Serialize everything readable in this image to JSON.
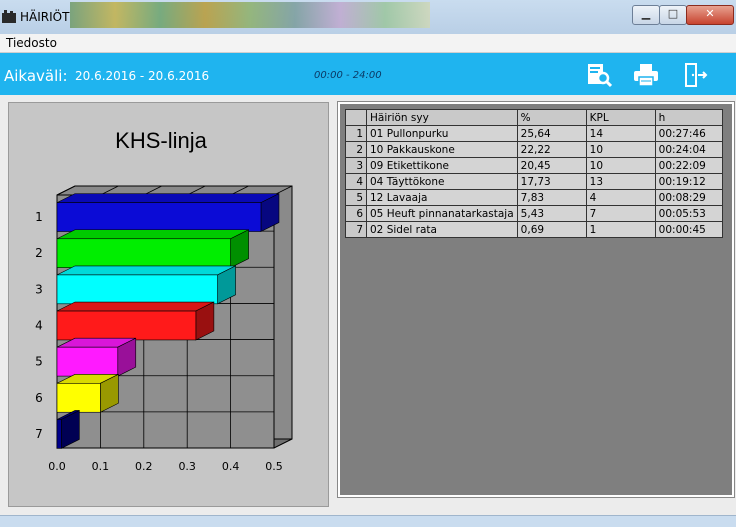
{
  "window": {
    "title": "HÄIRIÖT"
  },
  "menu": {
    "file": "Tiedosto"
  },
  "toolbar": {
    "period_label": "Aikaväli:",
    "dates": "20.6.2016  -  20.6.2016",
    "time": "00:00 - 24:00",
    "icons": [
      "search-report-icon",
      "printer-icon",
      "exit-icon"
    ]
  },
  "grid": {
    "headers": [
      "",
      "Häiriön syy",
      "%",
      "KPL",
      "h"
    ],
    "rows": [
      [
        "1",
        "01 Pullonpurku",
        "25,64",
        "14",
        "00:27:46"
      ],
      [
        "2",
        "10 Pakkauskone",
        "22,22",
        "10",
        "00:24:04"
      ],
      [
        "3",
        "09 Etikettikone",
        "20,45",
        "10",
        "00:22:09"
      ],
      [
        "4",
        "04 Täyttökone",
        "17,73",
        "13",
        "00:19:12"
      ],
      [
        "5",
        "12 Lavaaja",
        "7,83",
        "4",
        "00:08:29"
      ],
      [
        "6",
        "05 Heuft pinnanatarkastaja",
        "5,43",
        "7",
        "00:05:53"
      ],
      [
        "7",
        "02 Sidel rata",
        "0,69",
        "1",
        "00:00:45"
      ]
    ]
  },
  "chart_data": {
    "type": "bar",
    "orientation": "horizontal",
    "title": "KHS-linja",
    "categories": [
      "1",
      "2",
      "3",
      "4",
      "5",
      "6",
      "7"
    ],
    "values": [
      0.47,
      0.4,
      0.37,
      0.32,
      0.14,
      0.1,
      0.01
    ],
    "colors": [
      "#0b0bd6",
      "#00ee00",
      "#00ffff",
      "#ff1a1a",
      "#ff1aff",
      "#ffff00",
      "#00008a"
    ],
    "xlim": [
      0,
      0.5
    ],
    "xticks": [
      "0.0",
      "0.1",
      "0.2",
      "0.3",
      "0.4",
      "0.5"
    ],
    "grid": true
  }
}
